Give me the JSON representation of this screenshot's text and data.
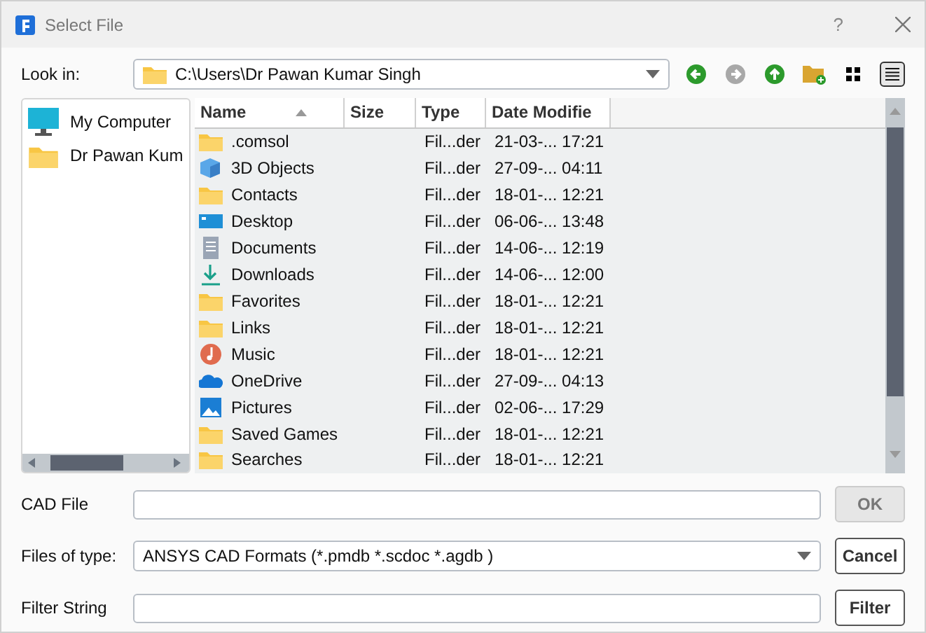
{
  "window": {
    "title": "Select File",
    "help": "?"
  },
  "look_in": {
    "label": "Look in:",
    "path": "C:\\Users\\Dr Pawan Kumar Singh"
  },
  "nav_buttons": [
    {
      "kind": "back",
      "disabled": false
    },
    {
      "kind": "forward",
      "disabled": true
    },
    {
      "kind": "up",
      "disabled": false
    },
    {
      "kind": "new-folder",
      "disabled": false
    }
  ],
  "view_buttons": [
    {
      "kind": "icons",
      "selected": false
    },
    {
      "kind": "details",
      "selected": true
    }
  ],
  "sidebar": {
    "items": [
      {
        "kind": "computer",
        "label": "My Computer"
      },
      {
        "kind": "folder",
        "label": "Dr Pawan Kum"
      }
    ]
  },
  "table": {
    "columns": [
      "Name",
      "Size",
      "Type",
      "Date Modifie"
    ],
    "rows": [
      {
        "kind": "folder",
        "name": ".comsol",
        "type": "Fil...der",
        "date": "21-03-... 17:21"
      },
      {
        "kind": "cube",
        "name": "3D Objects",
        "type": "Fil...der",
        "date": "27-09-... 04:11"
      },
      {
        "kind": "folder",
        "name": "Contacts",
        "type": "Fil...der",
        "date": "18-01-... 12:21"
      },
      {
        "kind": "desktop",
        "name": "Desktop",
        "type": "Fil...der",
        "date": "06-06-... 13:48"
      },
      {
        "kind": "document",
        "name": "Documents",
        "type": "Fil...der",
        "date": "14-06-... 12:19"
      },
      {
        "kind": "download",
        "name": "Downloads",
        "type": "Fil...der",
        "date": "14-06-... 12:00"
      },
      {
        "kind": "folder",
        "name": "Favorites",
        "type": "Fil...der",
        "date": "18-01-... 12:21"
      },
      {
        "kind": "folder",
        "name": "Links",
        "type": "Fil...der",
        "date": "18-01-... 12:21"
      },
      {
        "kind": "music",
        "name": "Music",
        "type": "Fil...der",
        "date": "18-01-... 12:21"
      },
      {
        "kind": "cloud",
        "name": "OneDrive",
        "type": "Fil...der",
        "date": "27-09-... 04:13"
      },
      {
        "kind": "picture",
        "name": "Pictures",
        "type": "Fil...der",
        "date": "02-06-... 17:29"
      },
      {
        "kind": "folder",
        "name": "Saved Games",
        "type": "Fil...der",
        "date": "18-01-... 12:21"
      },
      {
        "kind": "folder",
        "name": "Searches",
        "type": "Fil...der",
        "date": "18-01-... 12:21"
      }
    ]
  },
  "fields": [
    {
      "kind": "text",
      "label": "CAD File",
      "button": {
        "label": "OK",
        "disabled": true
      }
    },
    {
      "kind": "select",
      "label": "Files of type:",
      "value": "ANSYS CAD Formats (*.pmdb *.scdoc *.agdb )",
      "button": {
        "label": "Cancel",
        "disabled": false
      }
    },
    {
      "kind": "text",
      "label": "Filter String",
      "button": {
        "label": "Filter",
        "disabled": false
      }
    }
  ]
}
